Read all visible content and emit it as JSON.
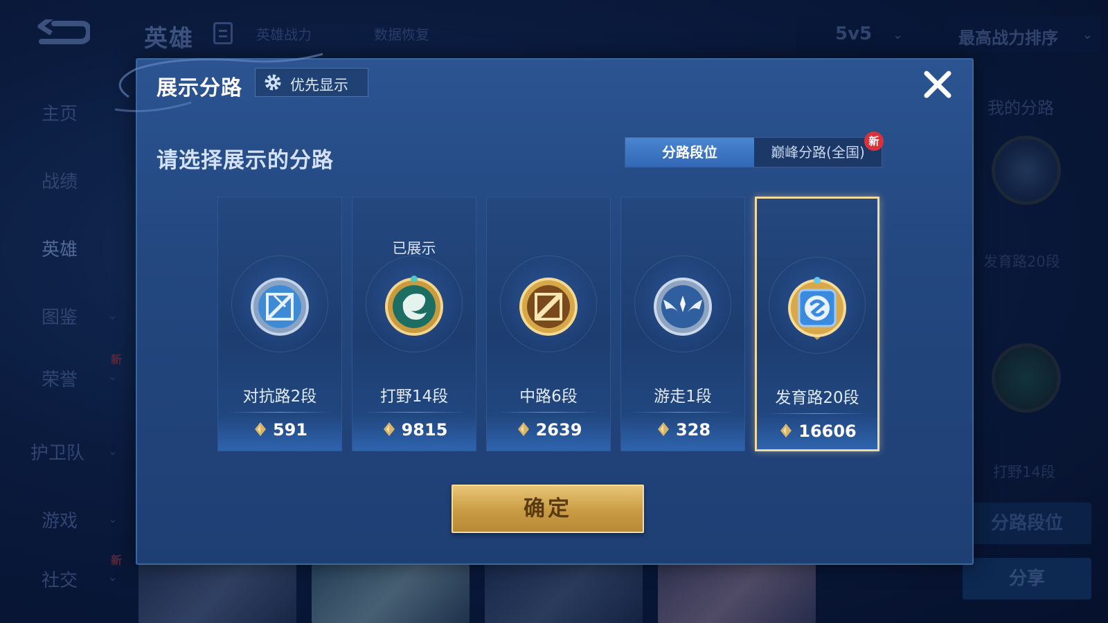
{
  "topbar": {
    "title": "英雄",
    "hero_power": "英雄战力",
    "data_restore": "数据恢复",
    "mode": "5v5",
    "sort": "最高战力排序"
  },
  "sidebar": {
    "items": [
      {
        "label": "主页"
      },
      {
        "label": "战绩"
      },
      {
        "label": "英雄"
      },
      {
        "label": "图鉴"
      },
      {
        "label": "荣誉",
        "badge": "新"
      },
      {
        "label": "护卫队"
      },
      {
        "label": "游戏"
      },
      {
        "label": "社交",
        "badge": "新"
      }
    ]
  },
  "right_panel": {
    "title": "我的分路",
    "lane_1": "发育路20段",
    "lane_2": "打野14段",
    "button_1": "分路段位",
    "button_2": "分享"
  },
  "modal": {
    "title": "展示分路",
    "priority_button": "优先显示",
    "subtitle": "请选择展示的分路",
    "tabs": [
      {
        "label": "分路段位",
        "active": true
      },
      {
        "label": "巅峰分路(全国)",
        "active": false
      }
    ],
    "new_badge": "新",
    "cards": [
      {
        "lane": "对抗路2段",
        "points": "591",
        "shown": "",
        "emblem": "clash-lane-icon",
        "selected": false
      },
      {
        "lane": "打野14段",
        "points": "9815",
        "shown": "已展示",
        "emblem": "jungle-icon",
        "selected": false
      },
      {
        "lane": "中路6段",
        "points": "2639",
        "shown": "",
        "emblem": "mid-lane-icon",
        "selected": false
      },
      {
        "lane": "游走1段",
        "points": "328",
        "shown": "",
        "emblem": "roam-icon",
        "selected": false
      },
      {
        "lane": "发育路20段",
        "points": "16606",
        "shown": "",
        "emblem": "farm-lane-icon",
        "selected": true
      }
    ],
    "confirm_button": "确定"
  },
  "colors": {
    "modal_bg": "#23477f",
    "tab_active": "#3f78c6",
    "confirm_gold": "#d4aa55",
    "selected_border": "#f2d9a0",
    "badge_red": "#d8323a"
  }
}
